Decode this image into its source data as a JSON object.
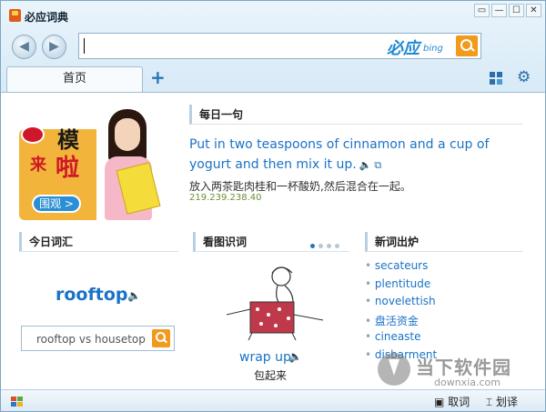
{
  "app": {
    "title": "必应词典",
    "window_buttons": [
      "▭",
      "—",
      "☐",
      "✕"
    ]
  },
  "nav": {
    "back_icon": "arrow-left-icon",
    "forward_icon": "arrow-right-icon"
  },
  "search": {
    "value": "",
    "brand": "必应",
    "brand_sub": "bing"
  },
  "tabs": [
    {
      "label": "首页"
    }
  ],
  "toolbar": {
    "add_icon": "plus-icon",
    "apps_icon": "grid-icon",
    "settings_icon": "gear-icon"
  },
  "promo": {
    "line1": "模",
    "line2": "来",
    "line3": "啦",
    "button": "围观 >"
  },
  "daily": {
    "heading": "每日一句",
    "english": "Put in two teaspoons of cinnamon and a cup of yogurt and then mix it up.",
    "chinese": "放入两茶匙肉桂和一杯酸奶,然后混合在一起。",
    "number": "219.239.238.40"
  },
  "vocab": {
    "heading": "今日词汇",
    "word": "rooftop",
    "compare": "rooftop vs housetop"
  },
  "picture": {
    "heading": "看图识词",
    "word": "wrap up",
    "chinese": "包起来"
  },
  "new_words": {
    "heading": "新词出炉",
    "items": [
      "secateurs",
      "plentitude",
      "novelettish",
      "盘活资金",
      "cineaste",
      "disbarment"
    ]
  },
  "status": {
    "lookup": "取词",
    "translate": "划译"
  },
  "watermark": {
    "title": "当下软件园",
    "url": "downxia.com"
  }
}
